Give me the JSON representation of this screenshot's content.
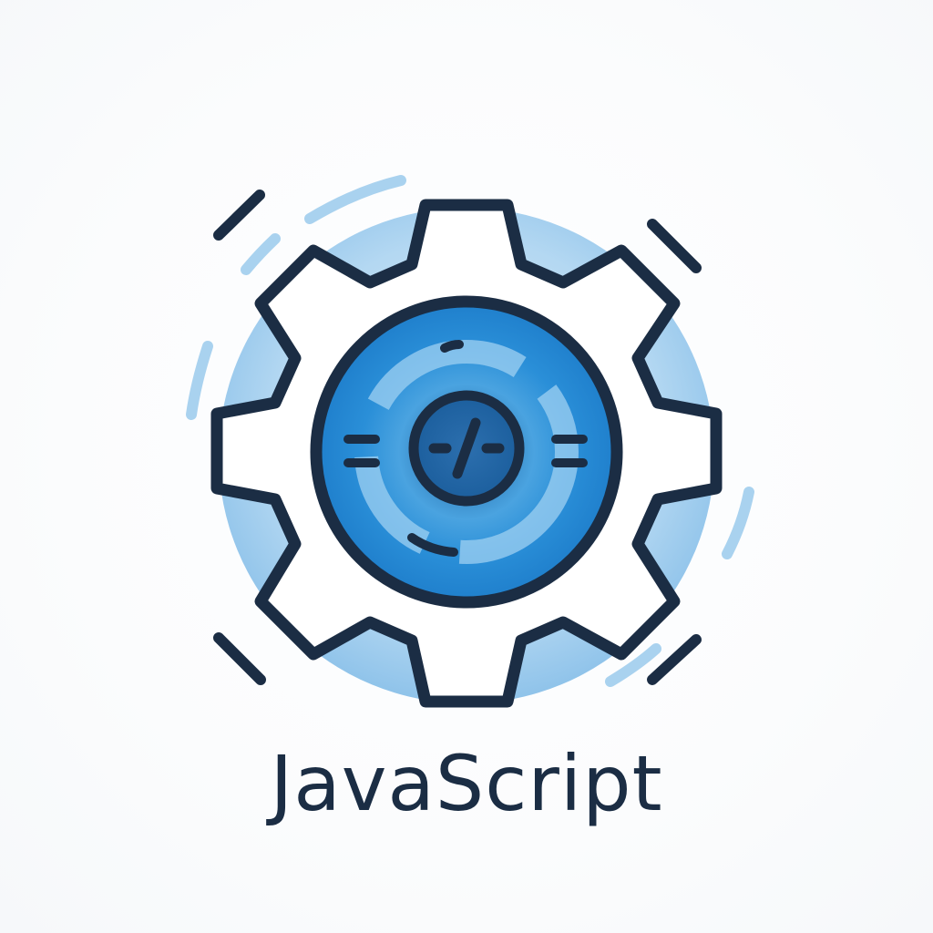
{
  "logo": {
    "title": "JavaScript",
    "emblem_icon": "gear-code-icon",
    "colors": {
      "outline": "#1b2d44",
      "accent_blue": "#2a8fd8",
      "light_blue": "#a9d2ef",
      "pale_blue": "#d6eaf8",
      "background": "#ffffff"
    }
  }
}
